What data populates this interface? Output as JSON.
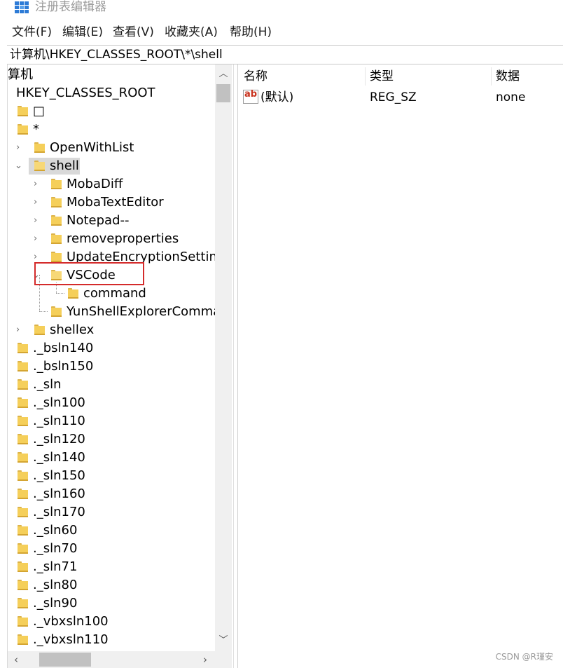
{
  "window": {
    "title": "注册表编辑器"
  },
  "menu": [
    "文件(F)",
    "编辑(E)",
    "查看(V)",
    "收藏夹(A)",
    "帮助(H)"
  ],
  "address": "计算机\\HKEY_CLASSES_ROOT\\*\\shell",
  "tree": {
    "root_label": "算机",
    "hive": "HKEY_CLASSES_ROOT",
    "items": [
      {
        "label": "□"
      },
      {
        "label": "*"
      },
      {
        "label": "OpenWithList"
      },
      {
        "label": "shell"
      },
      {
        "label": "MobaDiff"
      },
      {
        "label": "MobaTextEditor"
      },
      {
        "label": "Notepad--"
      },
      {
        "label": "removeproperties"
      },
      {
        "label": "UpdateEncryptionSettings"
      },
      {
        "label": "VSCode"
      },
      {
        "label": "command"
      },
      {
        "label": "YunShellExplorerCommand"
      },
      {
        "label": "shellex"
      },
      {
        "label": "._bsln140"
      },
      {
        "label": "._bsln150"
      },
      {
        "label": "._sln"
      },
      {
        "label": "._sln100"
      },
      {
        "label": "._sln110"
      },
      {
        "label": "._sln120"
      },
      {
        "label": "._sln140"
      },
      {
        "label": "._sln150"
      },
      {
        "label": "._sln160"
      },
      {
        "label": "._sln170"
      },
      {
        "label": "._sln60"
      },
      {
        "label": "._sln70"
      },
      {
        "label": "._sln71"
      },
      {
        "label": "._sln80"
      },
      {
        "label": "._sln90"
      },
      {
        "label": "._vbxsln100"
      },
      {
        "label": "._vbxsln110"
      }
    ]
  },
  "list": {
    "headers": [
      "名称",
      "类型",
      "数据"
    ],
    "rows": [
      {
        "icon": "string-value-icon",
        "icon_text": "ab",
        "name": "(默认)",
        "type": "REG_SZ",
        "data": "none"
      }
    ]
  },
  "watermark": "CSDN @R瑾安",
  "colors": {
    "highlight_box": "#d42b2b",
    "folder": "#f5cf5a",
    "selected": "#d9d9d9"
  }
}
